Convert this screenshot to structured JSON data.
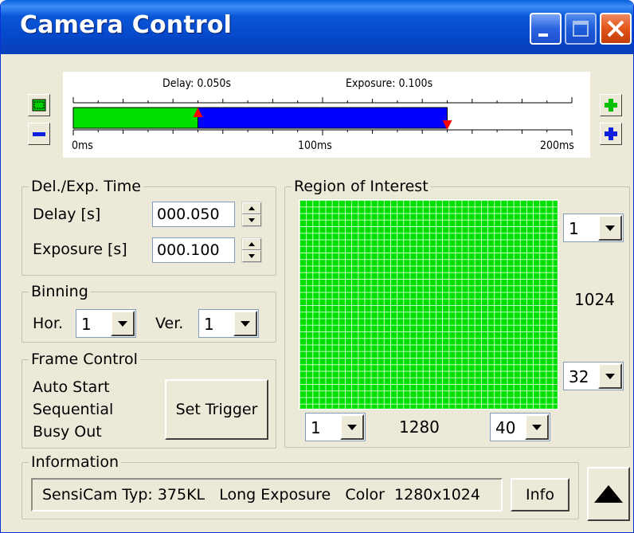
{
  "window": {
    "title": "Camera Control"
  },
  "timeline": {
    "delay_label": "Delay: 0.050s",
    "exposure_label": "Exposure: 0.100s",
    "axis_labels": [
      "0ms",
      "100ms",
      "200ms"
    ],
    "delay_s": 0.05,
    "exposure_s": 0.1,
    "range_ms": 200,
    "delay_color": "#00e000",
    "exposure_color": "#0000ff",
    "marker_color": "#ff0000"
  },
  "del_exp": {
    "group_label": "Del./Exp. Time",
    "delay_label": "Delay [s]",
    "delay_value": "000.050",
    "exposure_label": "Exposure [s]",
    "exposure_value": "000.100"
  },
  "binning": {
    "group_label": "Binning",
    "hor_label": "Hor.",
    "hor_value": "1",
    "ver_label": "Ver.",
    "ver_value": "1"
  },
  "frame_control": {
    "group_label": "Frame Control",
    "items": [
      "Auto Start",
      "Sequential",
      "Busy Out"
    ],
    "set_trigger_label": "Set Trigger"
  },
  "roi": {
    "group_label": "Region of Interest",
    "right_top_value": "1",
    "height_value": "1024",
    "right_bottom_value": "32",
    "bottom_left_value": "1",
    "width_value": "1280",
    "bottom_right_value": "40",
    "grid_color": "#00e000"
  },
  "information": {
    "group_label": "Information",
    "text": "SensiCam Typ: 375KL   Long Exposure   Color  1280x1024",
    "info_button": "Info"
  },
  "icons": {
    "minimize": "minimize-icon",
    "maximize": "maximize-icon",
    "close": "close-icon",
    "zoom_fit": "zoom-fit-icon",
    "zoom_out": "zoom-out-icon",
    "zoom_in_green": "green-plus-icon",
    "zoom_in_blue": "blue-plus-icon",
    "collapse": "triangle-up-icon"
  }
}
